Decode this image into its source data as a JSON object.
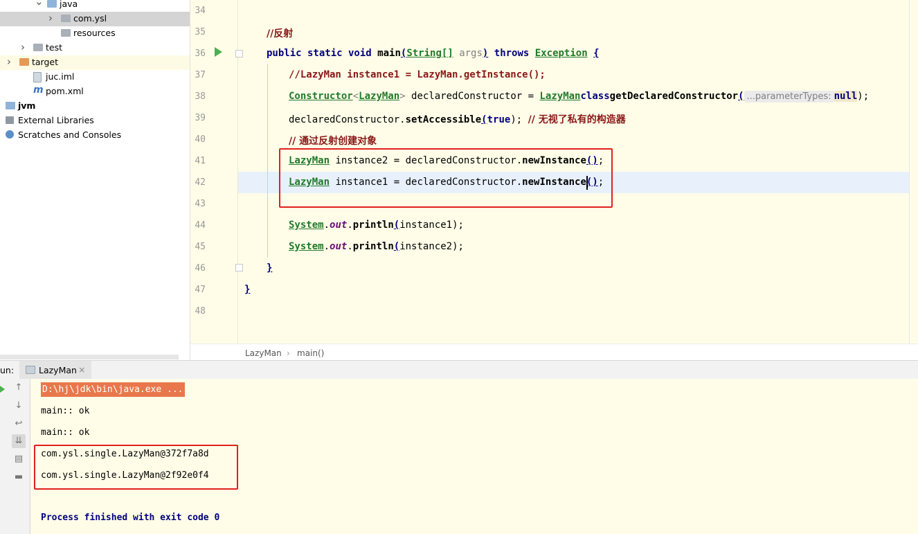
{
  "project_tree": [
    {
      "label": "java",
      "arrow": "v",
      "indent": 68,
      "icon": "folder-blue",
      "state": ""
    },
    {
      "label": "com.ysl",
      "arrow": ">",
      "indent": 88,
      "icon": "folder-gray",
      "state": "sel"
    },
    {
      "label": "resources",
      "arrow": "",
      "indent": 88,
      "icon": "folder-gray",
      "state": ""
    },
    {
      "label": "test",
      "arrow": ">",
      "indent": 48,
      "icon": "folder-gray",
      "state": ""
    },
    {
      "label": "target",
      "arrow": ">",
      "indent": 28,
      "icon": "folder-orange",
      "state": "hl"
    },
    {
      "label": "juc.iml",
      "arrow": "",
      "indent": 48,
      "icon": "file",
      "state": ""
    },
    {
      "label": "pom.xml",
      "arrow": "",
      "indent": 48,
      "icon": "maven",
      "state": ""
    },
    {
      "label": "jvm",
      "arrow": ">",
      "indent": 8,
      "icon": "folder-blue",
      "state": "bold"
    },
    {
      "label": "External Libraries",
      "arrow": "",
      "indent": 8,
      "icon": "lib",
      "state": ""
    },
    {
      "label": "Scratches and Consoles",
      "arrow": "",
      "indent": 8,
      "icon": "scratch",
      "state": ""
    }
  ],
  "maven_icon_glyph": "m",
  "line_numbers": [
    "34",
    "35",
    "36",
    "37",
    "38",
    "39",
    "40",
    "41",
    "42",
    "43",
    "44",
    "45",
    "46",
    "47",
    "48"
  ],
  "code": {
    "l35_comment": "//反射",
    "l36": {
      "kw1": "public static void ",
      "name": "main",
      "p1": "(",
      "t": "String[]",
      "sp": " ",
      "arg": "args",
      "p2": ")",
      "kw2": " throws ",
      "ex": "Exception",
      "sp2": " ",
      "br": "{"
    },
    "l37_comment": "//LazyMan instance1 = LazyMan.getInstance();",
    "l38": {
      "c1": "Constructor",
      "lt": "<",
      "c2": "LazyMan",
      "gt": ">",
      "v": " declaredConstructor = ",
      "c3": "LazyMan",
      ".": ".",
      "kw": "class",
      ".2": ".",
      "m": "getDeclaredConstructor",
      "op": "(",
      "hint": "...parameterTypes:",
      "nul": "null",
      "cl": ");"
    },
    "l39": {
      "v": "declaredConstructor.",
      "m": "setAccessible",
      "op": "(",
      "kw": "true",
      "cl": ");",
      "sp": " ",
      "cm": "// 无视了私有的构造器"
    },
    "l40_comment": "// 通过反射创建对象",
    "l41": {
      "c": "LazyMan",
      "v": " instance2 = declaredConstructor.",
      "m": "newInstance",
      "p": "()",
      "sc": ";"
    },
    "l42": {
      "c": "LazyMan",
      "v": " instance1 = declaredConstructor.",
      "m": "newInstance",
      "p": "()",
      "sc": ";"
    },
    "l44": {
      "c": "System",
      "d": ".",
      "f": "out",
      "d2": ".",
      "m": "println",
      "op": "(",
      "a": "instance1",
      "cl": ");"
    },
    "l45": {
      "c": "System",
      "d": ".",
      "f": "out",
      "d2": ".",
      "m": "println",
      "op": "(",
      "a": "instance2",
      "cl": ");"
    },
    "l46": "}",
    "l47": "}"
  },
  "breadcrumb": {
    "cls": "LazyMan",
    "sep": "›",
    "method": "main()"
  },
  "run": {
    "label": "un:",
    "tab": "LazyMan",
    "close": "×",
    "console": [
      "D:\\hj\\jdk\\bin\\java.exe ...",
      "main:: ok",
      "main:: ok",
      "com.ysl.single.LazyMan@372f7a8d",
      "com.ysl.single.LazyMan@2f92e0f4",
      "Process finished with exit code 0"
    ]
  },
  "toolbar_icons": {
    "up": "↑",
    "down": "↓",
    "wrap": "↩",
    "scroll": "⇊",
    "print": "▤",
    "trash": "▬"
  }
}
